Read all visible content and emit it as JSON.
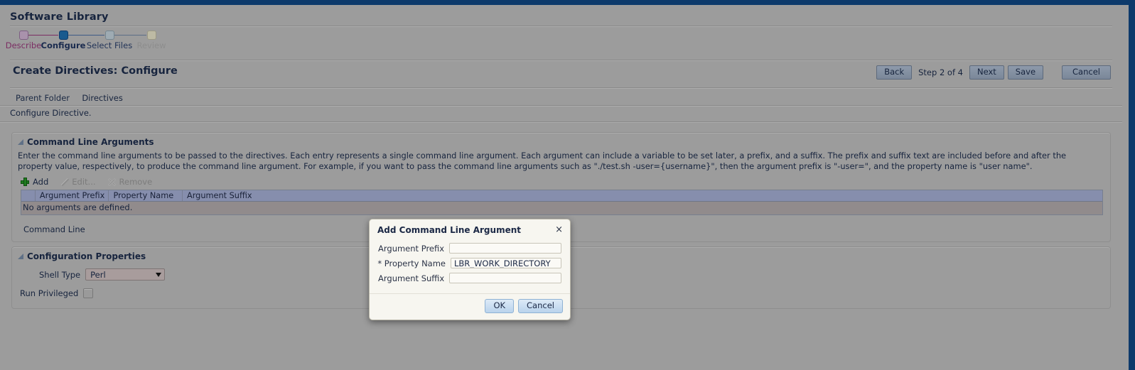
{
  "app": {
    "title": "Software Library"
  },
  "train": {
    "steps": [
      {
        "label": "Describe",
        "state": "done"
      },
      {
        "label": "Configure",
        "state": "current"
      },
      {
        "label": "Select Files",
        "state": "next"
      },
      {
        "label": "Review",
        "state": "disabled"
      }
    ]
  },
  "header": {
    "page_title": "Create Directives: Configure",
    "back_label": "Back",
    "step_text": "Step 2 of 4",
    "next_label": "Next",
    "save_label": "Save",
    "cancel_label": "Cancel"
  },
  "breadcrumb": {
    "parent_folder_label": "Parent Folder",
    "parent_folder_value": "Directives"
  },
  "instruction": "Configure Directive.",
  "cla_panel": {
    "title": "Command Line Arguments",
    "description": "Enter the command line arguments to be passed to the directives. Each entry represents a single command line argument. Each argument can include a variable to be set later, a prefix, and a suffix. The prefix and suffix text are included before and after the property value, respectively, to produce the command line argument. For example, if you want to pass the command line arguments such as \"./test.sh -user={username}\", then the argument prefix is \"-user=\", and the property name is \"user name\".",
    "toolbar": {
      "add_label": "Add",
      "edit_label": "Edit...",
      "remove_label": "Remove"
    },
    "table": {
      "columns": [
        "Argument Prefix",
        "Property Name",
        "Argument Suffix"
      ],
      "empty_text": "No arguments are defined.",
      "rows": []
    },
    "command_line_label": "Command Line",
    "command_line_value": ""
  },
  "config_panel": {
    "title": "Configuration Properties",
    "shell_type_label": "Shell Type",
    "shell_type_value": "Perl",
    "run_privileged_label": "Run Privileged",
    "run_privileged_checked": false
  },
  "dialog": {
    "title": "Add Command Line Argument",
    "close_glyph": "×",
    "fields": [
      {
        "label": "Argument Prefix",
        "value": "",
        "required": false
      },
      {
        "label": "* Property Name",
        "value": "LBR_WORK_DIRECTORY",
        "required": true
      },
      {
        "label": "Argument Suffix",
        "value": "",
        "required": false
      }
    ],
    "ok_label": "OK",
    "cancel_label": "Cancel"
  },
  "colors": {
    "page_bg": "#9c9c9c",
    "window_border": "#0d3a6b",
    "accent_text": "#17243e",
    "table_header": "#868ead",
    "dialog_bg": "#f7f6f0",
    "add_icon_green": "#1f7a1f"
  }
}
